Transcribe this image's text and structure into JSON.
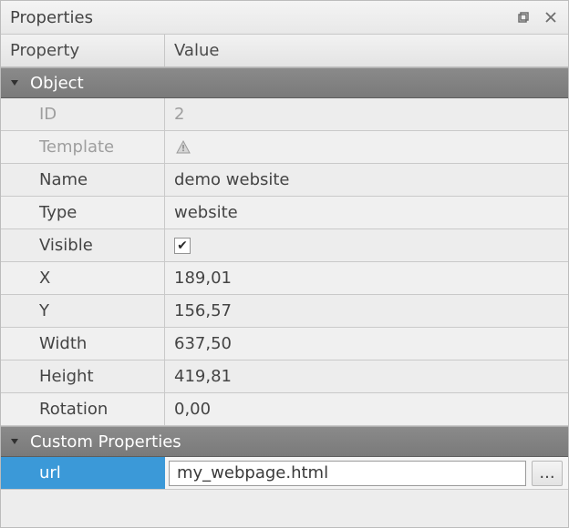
{
  "panel": {
    "title": "Properties"
  },
  "columns": {
    "prop": "Property",
    "val": "Value"
  },
  "sections": {
    "object": "Object",
    "custom": "Custom Properties"
  },
  "props": {
    "id": {
      "label": "ID",
      "value": "2"
    },
    "template": {
      "label": "Template",
      "value": ""
    },
    "name": {
      "label": "Name",
      "value": "demo website"
    },
    "type": {
      "label": "Type",
      "value": "website"
    },
    "visible": {
      "label": "Visible",
      "checked": true
    },
    "x": {
      "label": "X",
      "value": "189,01"
    },
    "y": {
      "label": "Y",
      "value": "156,57"
    },
    "width": {
      "label": "Width",
      "value": "637,50"
    },
    "height": {
      "label": "Height",
      "value": "419,81"
    },
    "rotation": {
      "label": "Rotation",
      "value": "0,00"
    }
  },
  "custom": {
    "url": {
      "label": "url",
      "value": "my_webpage.html"
    }
  },
  "ellipsis": "..."
}
